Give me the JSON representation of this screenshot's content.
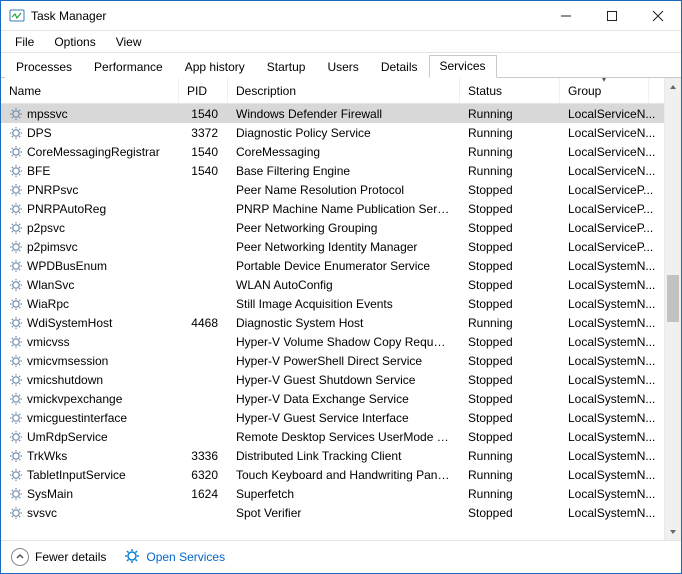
{
  "window": {
    "title": "Task Manager"
  },
  "menubar": [
    "File",
    "Options",
    "View"
  ],
  "tabs": [
    {
      "label": "Processes",
      "active": false
    },
    {
      "label": "Performance",
      "active": false
    },
    {
      "label": "App history",
      "active": false
    },
    {
      "label": "Startup",
      "active": false
    },
    {
      "label": "Users",
      "active": false
    },
    {
      "label": "Details",
      "active": false
    },
    {
      "label": "Services",
      "active": true
    }
  ],
  "columns": {
    "name": "Name",
    "pid": "PID",
    "desc": "Description",
    "status": "Status",
    "group": "Group",
    "sorted": "group",
    "sort_dir": "desc"
  },
  "services": [
    {
      "name": "mpssvc",
      "pid": "1540",
      "desc": "Windows Defender Firewall",
      "status": "Running",
      "group": "LocalServiceN...",
      "selected": true
    },
    {
      "name": "DPS",
      "pid": "3372",
      "desc": "Diagnostic Policy Service",
      "status": "Running",
      "group": "LocalServiceN..."
    },
    {
      "name": "CoreMessagingRegistrar",
      "pid": "1540",
      "desc": "CoreMessaging",
      "status": "Running",
      "group": "LocalServiceN..."
    },
    {
      "name": "BFE",
      "pid": "1540",
      "desc": "Base Filtering Engine",
      "status": "Running",
      "group": "LocalServiceN..."
    },
    {
      "name": "PNRPsvc",
      "pid": "",
      "desc": "Peer Name Resolution Protocol",
      "status": "Stopped",
      "group": "LocalServiceP..."
    },
    {
      "name": "PNRPAutoReg",
      "pid": "",
      "desc": "PNRP Machine Name Publication Servi...",
      "status": "Stopped",
      "group": "LocalServiceP..."
    },
    {
      "name": "p2psvc",
      "pid": "",
      "desc": "Peer Networking Grouping",
      "status": "Stopped",
      "group": "LocalServiceP..."
    },
    {
      "name": "p2pimsvc",
      "pid": "",
      "desc": "Peer Networking Identity Manager",
      "status": "Stopped",
      "group": "LocalServiceP..."
    },
    {
      "name": "WPDBusEnum",
      "pid": "",
      "desc": "Portable Device Enumerator Service",
      "status": "Stopped",
      "group": "LocalSystemN..."
    },
    {
      "name": "WlanSvc",
      "pid": "",
      "desc": "WLAN AutoConfig",
      "status": "Stopped",
      "group": "LocalSystemN..."
    },
    {
      "name": "WiaRpc",
      "pid": "",
      "desc": "Still Image Acquisition Events",
      "status": "Stopped",
      "group": "LocalSystemN..."
    },
    {
      "name": "WdiSystemHost",
      "pid": "4468",
      "desc": "Diagnostic System Host",
      "status": "Running",
      "group": "LocalSystemN..."
    },
    {
      "name": "vmicvss",
      "pid": "",
      "desc": "Hyper-V Volume Shadow Copy Reques...",
      "status": "Stopped",
      "group": "LocalSystemN..."
    },
    {
      "name": "vmicvmsession",
      "pid": "",
      "desc": "Hyper-V PowerShell Direct Service",
      "status": "Stopped",
      "group": "LocalSystemN..."
    },
    {
      "name": "vmicshutdown",
      "pid": "",
      "desc": "Hyper-V Guest Shutdown Service",
      "status": "Stopped",
      "group": "LocalSystemN..."
    },
    {
      "name": "vmickvpexchange",
      "pid": "",
      "desc": "Hyper-V Data Exchange Service",
      "status": "Stopped",
      "group": "LocalSystemN..."
    },
    {
      "name": "vmicguestinterface",
      "pid": "",
      "desc": "Hyper-V Guest Service Interface",
      "status": "Stopped",
      "group": "LocalSystemN..."
    },
    {
      "name": "UmRdpService",
      "pid": "",
      "desc": "Remote Desktop Services UserMode Po...",
      "status": "Stopped",
      "group": "LocalSystemN..."
    },
    {
      "name": "TrkWks",
      "pid": "3336",
      "desc": "Distributed Link Tracking Client",
      "status": "Running",
      "group": "LocalSystemN..."
    },
    {
      "name": "TabletInputService",
      "pid": "6320",
      "desc": "Touch Keyboard and Handwriting Pane...",
      "status": "Running",
      "group": "LocalSystemN..."
    },
    {
      "name": "SysMain",
      "pid": "1624",
      "desc": "Superfetch",
      "status": "Running",
      "group": "LocalSystemN..."
    },
    {
      "name": "svsvc",
      "pid": "",
      "desc": "Spot Verifier",
      "status": "Stopped",
      "group": "LocalSystemN..."
    }
  ],
  "footer": {
    "fewer": "Fewer details",
    "open": "Open Services"
  },
  "scrollbar": {
    "thumb_top_pct": 42,
    "thumb_height_pct": 11
  },
  "colors": {
    "accent": "#0066cc",
    "selection": "#d8d8d8"
  }
}
